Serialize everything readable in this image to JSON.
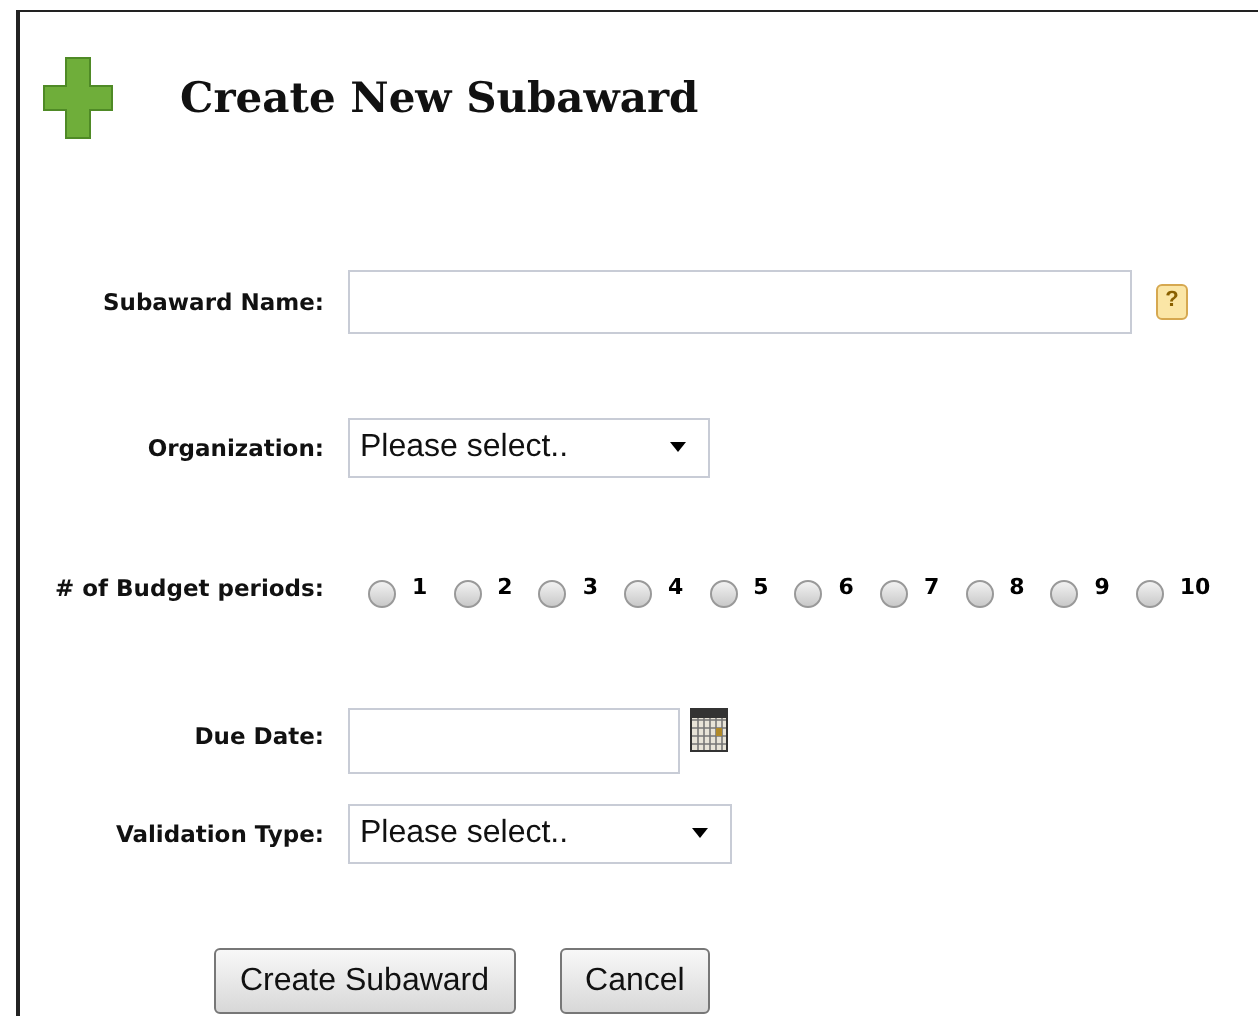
{
  "title": "Create New Subaward",
  "fields": [
    {
      "kind": "text",
      "label": "Subaward Name:",
      "help": "?"
    },
    {
      "kind": "select",
      "label": "Organization:",
      "value": "Please select.."
    },
    {
      "kind": "radios",
      "label": "# of Budget periods:",
      "options": [
        {
          "label": "1",
          "selected": false
        },
        {
          "label": "2",
          "selected": false
        },
        {
          "label": "3",
          "selected": false
        },
        {
          "label": "4",
          "selected": false
        },
        {
          "label": "5",
          "selected": false
        },
        {
          "label": "6",
          "selected": false
        },
        {
          "label": "7",
          "selected": false
        },
        {
          "label": "8",
          "selected": false
        },
        {
          "label": "9",
          "selected": false
        },
        {
          "label": "10",
          "selected": false
        }
      ]
    },
    {
      "kind": "date",
      "label": "Due Date:"
    },
    {
      "kind": "select",
      "label": "Validation Type:",
      "value": "Please select.."
    }
  ],
  "buttons": [
    "Create Subaward",
    "Cancel"
  ]
}
